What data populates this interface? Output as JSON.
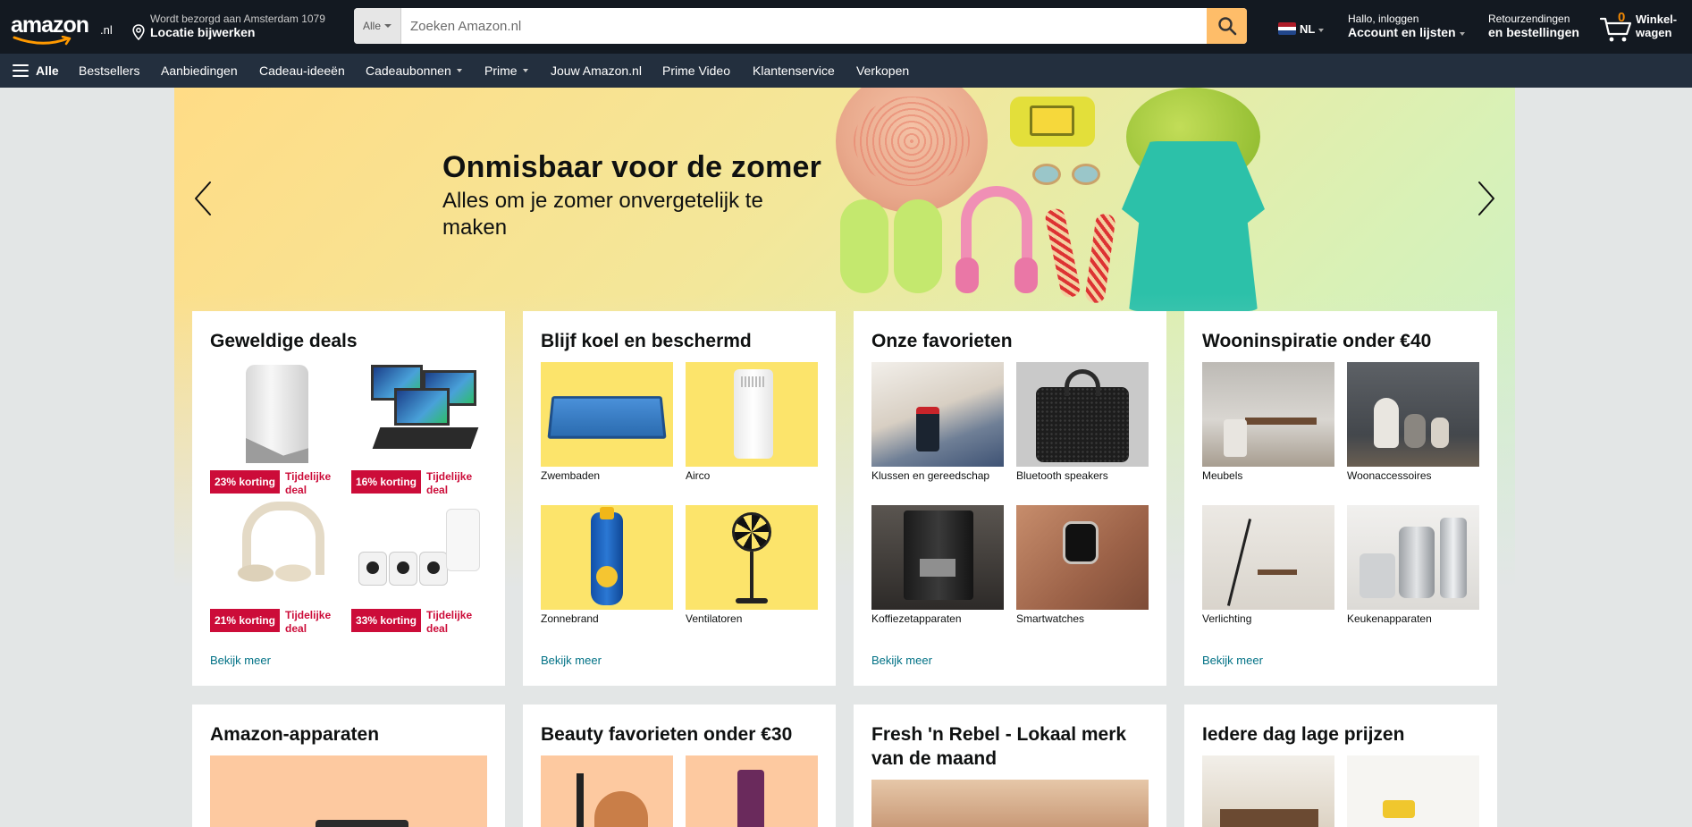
{
  "header": {
    "logo_text": "amazon",
    "logo_tld": ".nl",
    "deliver_line1": "Wordt bezorgd aan Amsterdam 1079",
    "deliver_line2": "Locatie bijwerken",
    "search_category": "Alle",
    "search_placeholder": "Zoeken Amazon.nl",
    "language": "NL",
    "account_line1": "Hallo, inloggen",
    "account_line2": "Account en lijsten",
    "returns_line1": "Retourzendingen",
    "returns_line2": "en bestellingen",
    "cart_count": "0",
    "cart_line1": "Winkel-",
    "cart_line2": "wagen"
  },
  "subnav": {
    "all": "Alle",
    "items": [
      "Bestsellers",
      "Aanbiedingen",
      "Cadeau-ideeën",
      "Cadeaubonnen",
      "Prime",
      "Jouw Amazon.nl",
      "Prime Video",
      "Klantenservice",
      "Verkopen"
    ]
  },
  "hero": {
    "title": "Onmisbaar voor de zomer",
    "subtitle": "Alles om je zomer onvergetelijk te maken"
  },
  "cards": [
    {
      "title": "Geweldige deals",
      "deals": [
        {
          "badge": "23% korting",
          "tag": "Tijdelijke deal",
          "product": "router"
        },
        {
          "badge": "16% korting",
          "tag": "Tijdelijke deal",
          "product": "laptop-monitors"
        },
        {
          "badge": "21% korting",
          "tag": "Tijdelijke deal",
          "product": "headphones"
        },
        {
          "badge": "33% korting",
          "tag": "Tijdelijke deal",
          "product": "security-cameras"
        }
      ],
      "more": "Bekijk meer"
    },
    {
      "title": "Blijf koel en beschermd",
      "tiles": [
        "Zwembaden",
        "Airco",
        "Zonnebrand",
        "Ventilatoren"
      ],
      "more": "Bekijk meer"
    },
    {
      "title": "Onze favorieten",
      "tiles": [
        "Klussen en gereedschap",
        "Bluetooth speakers",
        "Koffiezetapparaten",
        "Smartwatches"
      ],
      "more": "Bekijk meer"
    },
    {
      "title": "Wooninspiratie onder €40",
      "tiles": [
        "Meubels",
        "Woonaccessoires",
        "Verlichting",
        "Keukenapparaten"
      ],
      "more": "Bekijk meer"
    }
  ],
  "cards_row2": [
    "Amazon-apparaten",
    "Beauty favorieten onder €30",
    "Fresh 'n Rebel - Lokaal merk van de maand",
    "Iedere dag lage prijzen"
  ],
  "colors": {
    "nav_bg": "#131921",
    "subnav_bg": "#232f3e",
    "search_button": "#febd69",
    "deal_red": "#cc0c39",
    "link_teal": "#007185",
    "cart_orange": "#f08804"
  },
  "icons": [
    "location-pin-icon",
    "search-icon",
    "cart-icon",
    "hamburger-icon",
    "chevron-left-icon",
    "chevron-right-icon"
  ]
}
